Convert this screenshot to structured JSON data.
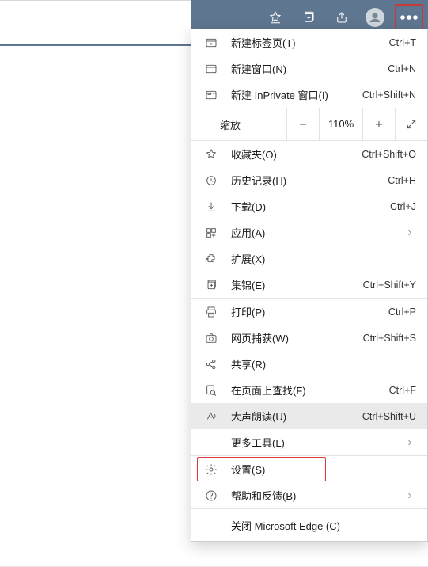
{
  "toolbar": {
    "zoom_page_icon": "zoom",
    "add_favorite_icon": "star-add",
    "favorites_icon": "star-list",
    "collections_icon": "collections",
    "share_icon": "share",
    "profile_icon": "profile",
    "more_icon": "more"
  },
  "menu": {
    "new_tab": {
      "label": "新建标签页(T)",
      "shortcut": "Ctrl+T"
    },
    "new_window": {
      "label": "新建窗口(N)",
      "shortcut": "Ctrl+N"
    },
    "new_inprivate": {
      "label": "新建 InPrivate 窗口(I)",
      "shortcut": "Ctrl+Shift+N"
    },
    "zoom": {
      "label": "缩放",
      "value": "110%"
    },
    "favorites": {
      "label": "收藏夹(O)",
      "shortcut": "Ctrl+Shift+O"
    },
    "history": {
      "label": "历史记录(H)",
      "shortcut": "Ctrl+H"
    },
    "downloads": {
      "label": "下载(D)",
      "shortcut": "Ctrl+J"
    },
    "apps": {
      "label": "应用(A)"
    },
    "extensions": {
      "label": "扩展(X)"
    },
    "collections": {
      "label": "集锦(E)",
      "shortcut": "Ctrl+Shift+Y"
    },
    "print": {
      "label": "打印(P)",
      "shortcut": "Ctrl+P"
    },
    "capture": {
      "label": "网页捕获(W)",
      "shortcut": "Ctrl+Shift+S"
    },
    "share": {
      "label": "共享(R)"
    },
    "find": {
      "label": "在页面上查找(F)",
      "shortcut": "Ctrl+F"
    },
    "read_aloud": {
      "label": "大声朗读(U)",
      "shortcut": "Ctrl+Shift+U"
    },
    "more_tools": {
      "label": "更多工具(L)"
    },
    "settings": {
      "label": "设置(S)"
    },
    "help": {
      "label": "帮助和反馈(B)"
    },
    "close": {
      "label": "关闭 Microsoft Edge (C)"
    }
  }
}
